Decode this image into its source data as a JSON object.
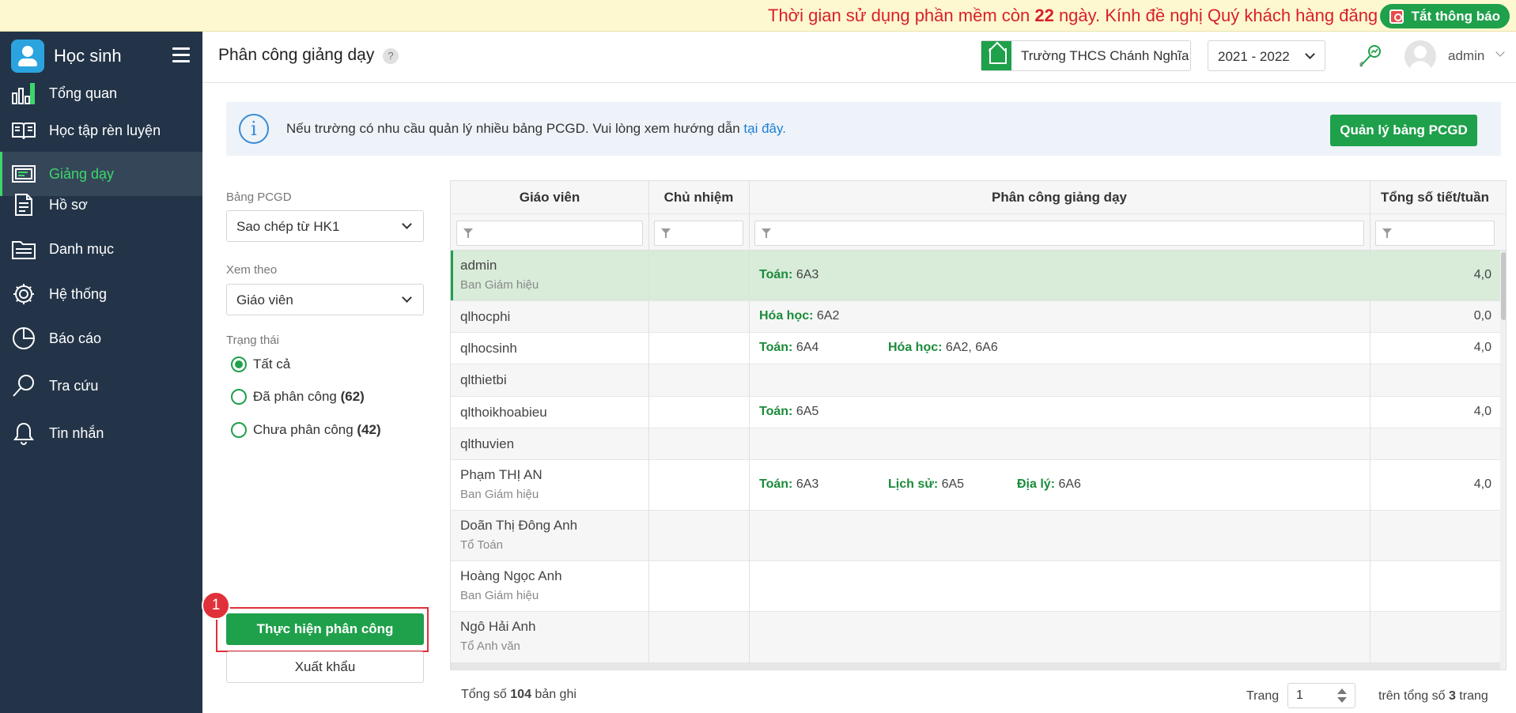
{
  "notice": {
    "text_before": "Thời gian sử dụng phần mềm còn ",
    "days": "22",
    "text_after": " ngày. Kính đề nghị Quý khách hàng đăng ký gia hạn",
    "close_label": "Tắt thông báo"
  },
  "sidebar": {
    "brand": "Học sinh",
    "items": [
      {
        "label": "Tổng quan",
        "icon": "bar-chart-icon"
      },
      {
        "label": "Học tập rèn luyện",
        "icon": "open-book-icon"
      },
      {
        "label": "Giảng dạy",
        "icon": "board-icon",
        "active": true
      },
      {
        "label": "Hồ sơ",
        "icon": "document-icon"
      },
      {
        "label": "Danh mục",
        "icon": "folder-icon"
      },
      {
        "label": "Hệ thống",
        "icon": "gear-icon"
      },
      {
        "label": "Báo cáo",
        "icon": "pie-chart-icon"
      },
      {
        "label": "Tra cứu",
        "icon": "search-icon"
      },
      {
        "label": "Tin nhắn",
        "icon": "bell-icon"
      }
    ]
  },
  "header": {
    "title": "Phân công giảng dạy",
    "help": "?",
    "school": "Trường THCS Chánh Nghĩa",
    "year": "2021 - 2022",
    "user": "admin"
  },
  "info": {
    "text": "Nếu trường có nhu cầu quản lý nhiều bảng PCGD. Vui lòng xem hướng dẫn ",
    "link": "tại đây.",
    "button": "Quản lý bảng PCGD"
  },
  "filters": {
    "table_label": "Bảng PCGD",
    "table_value": "Sao chép từ HK1",
    "view_label": "Xem theo",
    "view_value": "Giáo viên",
    "status_label": "Trạng thái",
    "options": [
      {
        "label": "Tất cả",
        "count": "",
        "selected": true
      },
      {
        "label": "Đã phân công ",
        "count": "(62)",
        "selected": false
      },
      {
        "label": "Chưa phân công ",
        "count": "(42)",
        "selected": false
      }
    ],
    "assign_button": "Thực hiện phân công",
    "step_badge": "1",
    "export_button": "Xuất khẩu"
  },
  "grid": {
    "columns": [
      "Giáo viên",
      "Chủ nhiệm",
      "Phân công giảng dạy",
      "Tổng số tiết/tuần"
    ],
    "rows": [
      {
        "name": "admin",
        "dept": "Ban Giám hiệu",
        "assign": [
          {
            "subject": "Toán",
            "classes": "6A3"
          }
        ],
        "total": "4,0"
      },
      {
        "name": "qlhocphi",
        "dept": "",
        "assign": [
          {
            "subject": "Hóa học",
            "classes": "6A2"
          }
        ],
        "total": "0,0"
      },
      {
        "name": "qlhocsinh",
        "dept": "",
        "assign": [
          {
            "subject": "Toán",
            "classes": "6A4"
          },
          {
            "subject": "Hóa học",
            "classes": "6A2, 6A6"
          }
        ],
        "total": "4,0"
      },
      {
        "name": "qlthietbi",
        "dept": "",
        "assign": [],
        "total": ""
      },
      {
        "name": "qlthoikhoabieu",
        "dept": "",
        "assign": [
          {
            "subject": "Toán",
            "classes": "6A5"
          }
        ],
        "total": "4,0"
      },
      {
        "name": "qlthuvien",
        "dept": "",
        "assign": [],
        "total": ""
      },
      {
        "name": "Phạm THỊ AN",
        "dept": "Ban Giám hiệu",
        "assign": [
          {
            "subject": "Toán",
            "classes": "6A3"
          },
          {
            "subject": "Lịch sử",
            "classes": "6A5"
          },
          {
            "subject": "Địa lý",
            "classes": "6A6"
          }
        ],
        "total": "4,0"
      },
      {
        "name": "Doãn Thị Đông Anh",
        "dept": "Tổ Toán",
        "assign": [],
        "total": ""
      },
      {
        "name": "Hoàng Ngọc Anh",
        "dept": "Ban Giám hiệu",
        "assign": [],
        "total": ""
      },
      {
        "name": "Ngô Hải Anh",
        "dept": "Tổ Anh văn",
        "assign": [],
        "total": ""
      }
    ]
  },
  "footer": {
    "count_prefix": "Tổng số ",
    "count": "104",
    "count_suffix": " bản ghi",
    "page_label": "Trang",
    "page_value": "1",
    "pages_prefix": "trên tổng số ",
    "pages": "3",
    "pages_suffix": " trang"
  },
  "colors": {
    "accent": "#1fa04b",
    "sidebar": "#233448",
    "active_text": "#3dd66b",
    "notice_text": "#d9202a",
    "selected_row": "#d8ecd9"
  }
}
